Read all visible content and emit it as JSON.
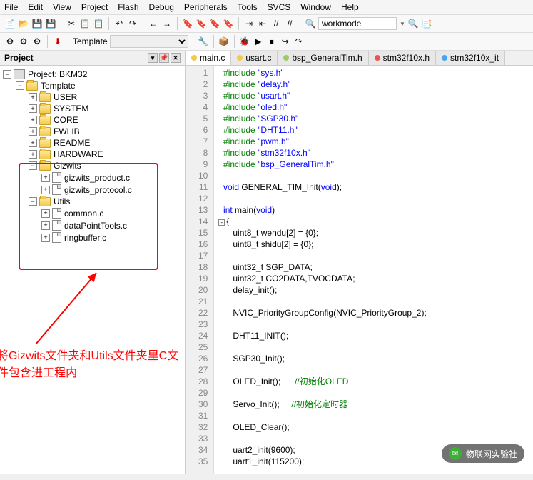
{
  "menu": [
    "File",
    "Edit",
    "View",
    "Project",
    "Flash",
    "Debug",
    "Peripherals",
    "Tools",
    "SVCS",
    "Window",
    "Help"
  ],
  "toolbar": {
    "template_label": "Template",
    "workmode_label": "workmode"
  },
  "project": {
    "title": "Project",
    "root": "Project: BKM32",
    "template": "Template",
    "folders_top": [
      "USER",
      "SYSTEM",
      "CORE",
      "FWLIB",
      "README",
      "HARDWARE"
    ],
    "gizwits": {
      "name": "Gizwits",
      "files": [
        "gizwits_product.c",
        "gizwits_protocol.c"
      ]
    },
    "utils": {
      "name": "Utils",
      "files": [
        "common.c",
        "dataPointTools.c",
        "ringbuffer.c"
      ]
    }
  },
  "annotation": "将Gizwits文件夹和Utils文件夹里C文件包含进工程内",
  "tabs": [
    {
      "name": "main.c",
      "color": "#f5c94b",
      "active": true
    },
    {
      "name": "usart.c",
      "color": "#f5c94b",
      "active": false
    },
    {
      "name": "bsp_GeneralTim.h",
      "color": "#9ccc65",
      "active": false
    },
    {
      "name": "stm32f10x.h",
      "color": "#ef5350",
      "active": false
    },
    {
      "name": "stm32f10x_it",
      "color": "#42a5f5",
      "active": false
    }
  ],
  "code": {
    "includes": [
      "sys.h",
      "delay.h",
      "usart.h",
      "oled.h",
      "SGP30.h",
      "DHT11.h",
      "pwm.h",
      "stm32f10x.h",
      "bsp_GeneralTim.h"
    ],
    "lines": [
      {
        "n": 1,
        "type": "inc",
        "i": 0
      },
      {
        "n": 2,
        "type": "inc",
        "i": 1
      },
      {
        "n": 3,
        "type": "inc",
        "i": 2
      },
      {
        "n": 4,
        "type": "inc",
        "i": 3
      },
      {
        "n": 5,
        "type": "inc",
        "i": 4
      },
      {
        "n": 6,
        "type": "inc",
        "i": 5
      },
      {
        "n": 7,
        "type": "inc",
        "i": 6
      },
      {
        "n": 8,
        "type": "inc",
        "i": 7
      },
      {
        "n": 9,
        "type": "inc",
        "i": 8
      },
      {
        "n": 10,
        "type": "blank"
      },
      {
        "n": 11,
        "type": "raw",
        "html": "  <span class='k-kw'>void</span> GENERAL_TIM_Init(<span class='k-kw'>void</span>);"
      },
      {
        "n": 12,
        "type": "blank"
      },
      {
        "n": 13,
        "type": "raw",
        "html": "  <span class='k-kw'>int</span> main(<span class='k-kw'>void</span>)"
      },
      {
        "n": 14,
        "type": "raw",
        "html": "<span class='fold'>-</span>{"
      },
      {
        "n": 15,
        "type": "raw",
        "html": "      uint8_t wendu[2] = {0};"
      },
      {
        "n": 16,
        "type": "raw",
        "html": "      uint8_t shidu[2] = {0};"
      },
      {
        "n": 17,
        "type": "blank"
      },
      {
        "n": 18,
        "type": "raw",
        "html": "      uint32_t SGP_DATA;"
      },
      {
        "n": 19,
        "type": "raw",
        "html": "      uint32_t CO2DATA,TVOCDATA;"
      },
      {
        "n": 20,
        "type": "raw",
        "html": "      delay_init();"
      },
      {
        "n": 21,
        "type": "blank"
      },
      {
        "n": 22,
        "type": "raw",
        "html": "      NVIC_PriorityGroupConfig(NVIC_PriorityGroup_2);"
      },
      {
        "n": 23,
        "type": "blank"
      },
      {
        "n": 24,
        "type": "raw",
        "html": "      DHT11_INIT();"
      },
      {
        "n": 25,
        "type": "blank"
      },
      {
        "n": 26,
        "type": "raw",
        "html": "      SGP30_Init();"
      },
      {
        "n": 27,
        "type": "blank"
      },
      {
        "n": 28,
        "type": "raw",
        "html": "      OLED_Init();      <span class='k-cmt'>//初始化OLED</span>"
      },
      {
        "n": 29,
        "type": "blank"
      },
      {
        "n": 30,
        "type": "raw",
        "html": "      Servo_Init();     <span class='k-cmt'>//初始化定时器</span>"
      },
      {
        "n": 31,
        "type": "blank"
      },
      {
        "n": 32,
        "type": "raw",
        "html": "      OLED_Clear();"
      },
      {
        "n": 33,
        "type": "blank"
      },
      {
        "n": 34,
        "type": "raw",
        "html": "      uart2_init(9600);"
      },
      {
        "n": 35,
        "type": "raw",
        "html": "      uart1_init(115200);"
      }
    ]
  },
  "watermark": "物联网实验社"
}
